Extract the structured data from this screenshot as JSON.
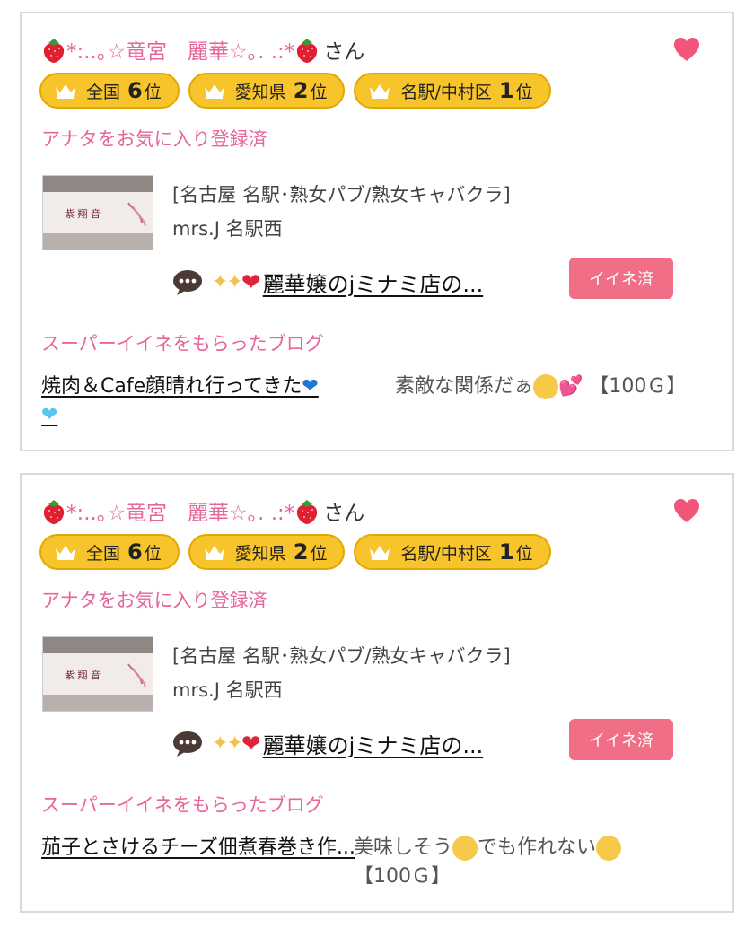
{
  "posts": [
    {
      "name_prefix": "*:..｡☆竜宮　麗華☆｡. .:*",
      "name_suffix": "さん",
      "badges": [
        {
          "label": "全国",
          "rank": "6",
          "unit": "位"
        },
        {
          "label": "愛知県",
          "rank": "2",
          "unit": "位"
        },
        {
          "label": "名駅/中村区",
          "rank": "1",
          "unit": "位"
        }
      ],
      "fav_status": "アナタをお気に入り登録済",
      "shop_category": "[名古屋 名駅･熟女パブ/熟女キャバクラ]",
      "shop_name": "mrs.J 名駅西",
      "blog_title": "麗華嬢のjミナミ店の...",
      "like_button": "イイネ済",
      "super_heading": "スーパーイイネをもらったブログ",
      "super_blog_title": "焼肉＆Cafe顔晴れ行ってきた",
      "super_comment_a": "素敵な関係だぁ",
      "super_comment_b": "【100Ｇ】"
    },
    {
      "name_prefix": "*:..｡☆竜宮　麗華☆｡. .:*",
      "name_suffix": "さん",
      "badges": [
        {
          "label": "全国",
          "rank": "6",
          "unit": "位"
        },
        {
          "label": "愛知県",
          "rank": "2",
          "unit": "位"
        },
        {
          "label": "名駅/中村区",
          "rank": "1",
          "unit": "位"
        }
      ],
      "fav_status": "アナタをお気に入り登録済",
      "shop_category": "[名古屋 名駅･熟女パブ/熟女キャバクラ]",
      "shop_name": "mrs.J 名駅西",
      "blog_title": "麗華嬢のjミナミ店の...",
      "like_button": "イイネ済",
      "super_heading": "スーパーイイネをもらったブログ",
      "super_blog_title": "茄子とさけるチーズ佃煮春巻き作...",
      "super_comment_a": "美味しそう",
      "super_comment_b": "でも作れない",
      "super_comment_c": "【100Ｇ】"
    }
  ],
  "colors": {
    "accent_pink": "#e6659a",
    "badge_gold": "#f7c42c",
    "like_button": "#f06e86",
    "heart": "#f2557a"
  },
  "icons": [
    "strawberry-icon",
    "heart-icon",
    "crown-icon",
    "speech-bubble-icon",
    "sparkles-icon",
    "red-heart-icon"
  ]
}
